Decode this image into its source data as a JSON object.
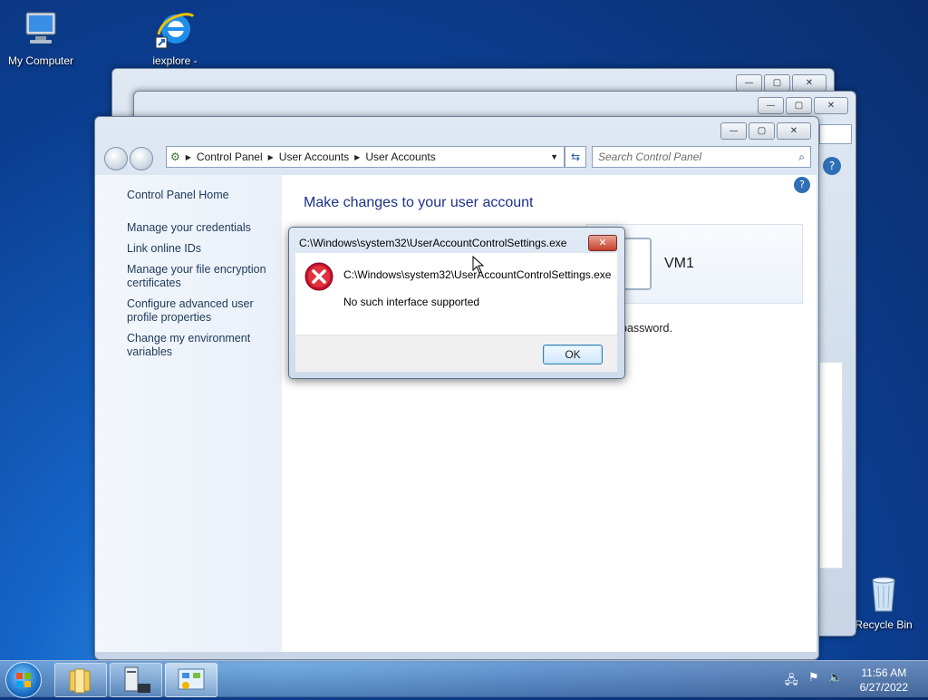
{
  "desktop": {
    "icons": [
      {
        "label": "My Computer"
      },
      {
        "label": "iexplore -"
      },
      {
        "label": "Recycle Bin"
      }
    ]
  },
  "main_window": {
    "breadcrumb": [
      "Control Panel",
      "User Accounts",
      "User Accounts"
    ],
    "search_placeholder": "Search Control Panel",
    "left_pane": {
      "home": "Control Panel Home",
      "links": [
        "Manage your credentials",
        "Link online IDs",
        "Manage your file encryption certificates",
        "Configure advanced user profile properties",
        "Change my environment variables"
      ]
    },
    "heading": "Make changes to your user account",
    "account_name": "VM1",
    "partial_text": "password."
  },
  "dialog": {
    "title": "C:\\Windows\\system32\\UserAccountControlSettings.exe",
    "message_path": "C:\\Windows\\system32\\UserAccountControlSettings.exe",
    "message": "No such interface supported",
    "ok_label": "OK",
    "close_glyph": "✕"
  },
  "taskbar": {
    "time": "11:56 AM",
    "date": "6/27/2022"
  },
  "colors": {
    "link": "#1e395b",
    "heading": "#1e3287",
    "error_red": "#c8102e"
  }
}
